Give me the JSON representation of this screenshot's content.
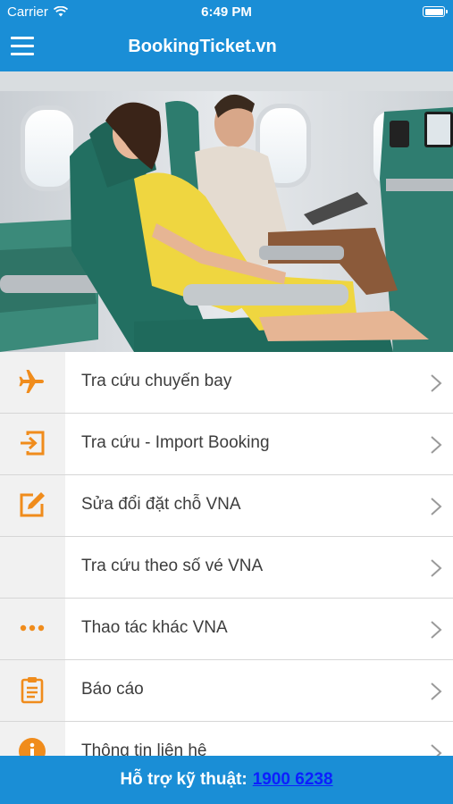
{
  "status_bar": {
    "carrier": "Carrier",
    "time": "6:49 PM"
  },
  "header": {
    "title": "BookingTicket.vn"
  },
  "menu": [
    {
      "label": "Tra cứu chuyến bay",
      "icon": "airplane-icon"
    },
    {
      "label": "Tra cứu - Import Booking",
      "icon": "import-icon"
    },
    {
      "label": "Sửa đổi đặt chỗ VNA",
      "icon": "edit-icon"
    },
    {
      "label": "Tra cứu theo số vé VNA",
      "icon": ""
    },
    {
      "label": "Thao tác khác VNA",
      "icon": "more-dots-icon"
    },
    {
      "label": "Báo cáo",
      "icon": "clipboard-icon"
    },
    {
      "label": "Thông tin liên hệ",
      "icon": "info-icon"
    }
  ],
  "footer": {
    "support_label": "Hỗ trợ kỹ thuật:",
    "phone": "1900 6238"
  },
  "colors": {
    "brand_blue": "#1a8ed6",
    "icon_orange": "#f08c1c",
    "link_blue": "#0c1fff"
  }
}
